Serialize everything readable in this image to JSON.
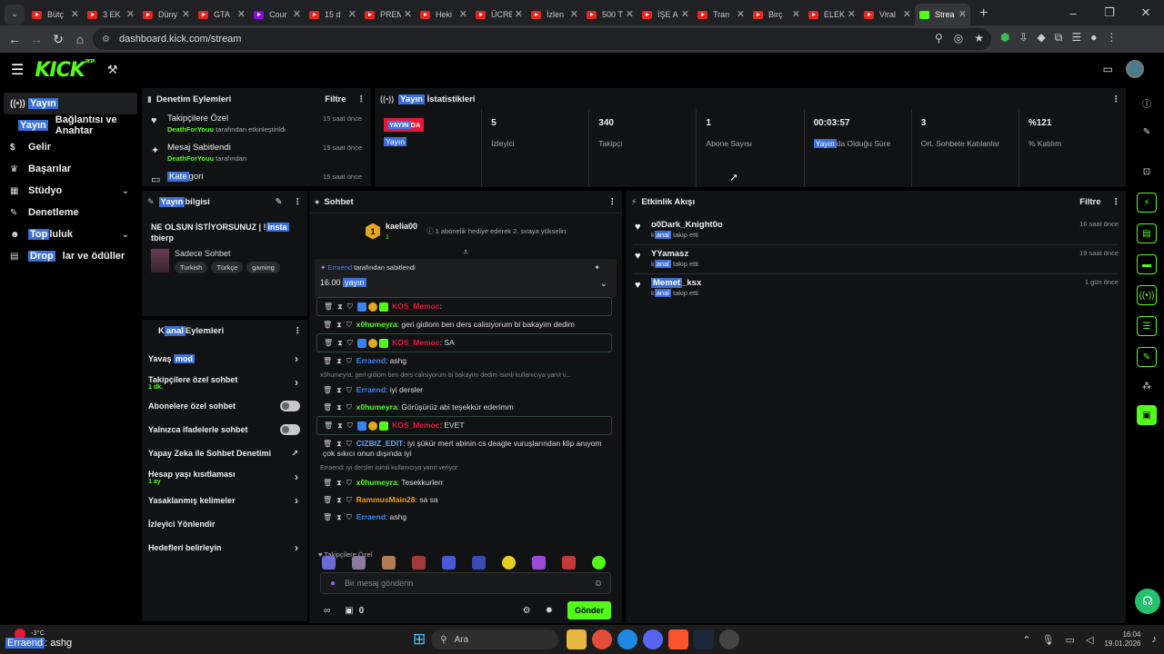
{
  "browser": {
    "tabs": [
      {
        "label": "Bütç"
      },
      {
        "label": "3 EK"
      },
      {
        "label": "Düny"
      },
      {
        "label": "GTA"
      },
      {
        "label": "Cour"
      },
      {
        "label": "15 d"
      },
      {
        "label": "PREM"
      },
      {
        "label": "Heki"
      },
      {
        "label": "ÜCRE"
      },
      {
        "label": "İzlen"
      },
      {
        "label": "500 T"
      },
      {
        "label": "İŞE A"
      },
      {
        "label": "Tran"
      },
      {
        "label": "Birç"
      },
      {
        "label": "ELEK"
      },
      {
        "label": "Viral"
      },
      {
        "label": "Strea"
      }
    ],
    "url": "dashboard.kick.com/stream"
  },
  "header": {
    "logo": "KICK",
    "logo_badge": "BETA"
  },
  "sidebar": {
    "items": [
      {
        "label": "Yayın",
        "icon": "broadcast-icon"
      },
      {
        "label_hl": "Yayın",
        "label": "Bağlantısı ve Anahtar"
      },
      {
        "label": "Gelir",
        "icon": "dollar-icon"
      },
      {
        "label": "Başarılar",
        "icon": "trophy-icon"
      },
      {
        "label": "Stüdyo",
        "icon": "grid-icon"
      },
      {
        "label": "Denetleme",
        "icon": "wrench-icon"
      },
      {
        "label_hl": "Top",
        "label": "luluk",
        "icon": "people-icon"
      },
      {
        "label_hl": "Drop",
        "label": "lar ve ödüller",
        "icon": "gift-icon"
      }
    ]
  },
  "mod_actions": {
    "title": "Denetim Eylemleri",
    "filter": "Filtre",
    "rows": [
      {
        "title": "Takipçilere Özel",
        "by": "DeathForYouu",
        "suffix": "tarafından etkinleştirildi",
        "time": "15 saat önce"
      },
      {
        "title": "Mesaj Sabitlendi",
        "by": "DeathForYouu",
        "suffix": "tarafından",
        "time": "15 saat önce"
      },
      {
        "title_hl": "Kate",
        "title": "gori",
        "time": "15 saat önce"
      }
    ]
  },
  "stats": {
    "title_hl": "Yayın",
    "title": "İstatistikleri",
    "live_badge_hl": "YAYIN",
    "live_badge": "DA",
    "live_sub": "Yayın",
    "cells": [
      {
        "value": "5",
        "label": "İzleyici"
      },
      {
        "value": "340",
        "label": "Takipçi"
      },
      {
        "value": "1",
        "label": "Abone Sayısı"
      },
      {
        "value": "00:03:57",
        "label_hl": "Yayın",
        "label": "da Olduğu Süre"
      },
      {
        "value": "3",
        "label": "Ort. Sohbete Katılanlar"
      },
      {
        "value": "%121",
        "label": "% Katılım"
      }
    ]
  },
  "stream_info": {
    "title_hl": "Yayın",
    "title": " bilgisi",
    "stream_title_a": "NE OLSUN İSTİYORSUNUZ | !",
    "stream_title_hl": "insta",
    "stream_title_b": "tbierp",
    "category": "Sadece Sohbet",
    "tags": [
      "Turkish",
      "Türkçe",
      "gaming"
    ]
  },
  "channel_actions": {
    "title_a": "K",
    "title_hl": "anal",
    "title_b": " Eylemleri",
    "rows": [
      {
        "label_a": "Yavaş ",
        "label_hl": "mod",
        "control": "arrow"
      },
      {
        "label": "Takipçilere özel sohbet",
        "sub": "1 dk.",
        "control": "arrow"
      },
      {
        "label": "Abonelere özel sohbet",
        "control": "toggle"
      },
      {
        "label": "Yalnızca ifadelerle sohbet",
        "control": "toggle"
      },
      {
        "label": "Yapay Zeka ile Sohbet Denetimi",
        "control": "external"
      },
      {
        "label": "Hesap yaşı kısıtlaması",
        "sub": "1 ay",
        "control": "arrow"
      },
      {
        "label": "Yasaklanmış kelimeler",
        "control": "arrow"
      },
      {
        "label": "İzleyici Yönlendir",
        "control": "none"
      },
      {
        "label": "Hedefleri belirleyin",
        "control": "arrow"
      }
    ]
  },
  "chat": {
    "title": "Sohbet",
    "gift": {
      "user": "kaelia00",
      "count": "1",
      "text": "1 abonelik hediye ederek 2. sıraya yükselin"
    },
    "pinned": {
      "by": "Erraend",
      "by_suffix": "tarafından sabitlendi",
      "text": "16.00 ",
      "text_hl": "yayın"
    },
    "messages": [
      {
        "user": "KOS_Memoc",
        "text": "",
        "color": "#e9183a",
        "boxed": true
      },
      {
        "user": "x0humeyra",
        "text": "geri gidiom ben ders calisiyorum bi bakayim dedim",
        "color": "#53fc18",
        "boxed": false
      },
      {
        "user": "KOS_Memoc",
        "text": "SA",
        "color": "#e9183a",
        "boxed": true
      },
      {
        "user": "Erraend",
        "text": "ashg",
        "color": "#3b82f6",
        "boxed": false
      },
      {
        "reply": "x0humeyra: geri gidiom ben ders calisiyorum bi bakayim dedim isimli kullanıcıya yanıt v...",
        "user": "Erraend",
        "text": "iyi dersler",
        "color": "#3b82f6",
        "boxed": false
      },
      {
        "user": "x0humeyra",
        "text": "Görüşürüz abi teşekkür ederimm",
        "color": "#53fc18",
        "boxed": false
      },
      {
        "user": "KOS_Memoc",
        "text": "EVET",
        "color": "#e9183a",
        "boxed": true
      },
      {
        "user": "CIZBIZ_EDIT",
        "text": "iyi şükür mert abinin cs deagle vuruşlarından klip anıyom çok sıkıcı onun dışında iyi",
        "color": "#60a5fa",
        "boxed": false
      },
      {
        "reply": "Erraend: iyi dersler isimli kullanıcıya yanıt veriyor",
        "user": "x0humeyra",
        "text": "Tesekkurlerr",
        "color": "#53fc18",
        "boxed": false
      },
      {
        "user": "RammusMain28",
        "text": "sa sa",
        "color": "#f59e0b",
        "boxed": false
      },
      {
        "user": "Erraend",
        "text": "ashg",
        "color": "#3b82f6",
        "boxed": false
      }
    ],
    "emote_label": "Takipçilere Özel",
    "input_placeholder": "Bir mesaj gönderin",
    "points": "0",
    "send": "Gönder"
  },
  "activity": {
    "title": "Etkinlik Akışı",
    "filter": "Filtre",
    "events": [
      {
        "name": "o0Dark_Knight0o",
        "sub_a": "k",
        "sub_hl": "anal",
        "sub_b": " takip etti",
        "time": "16 saat önce"
      },
      {
        "name": "YYamasz",
        "sub_a": "k",
        "sub_hl": "anal",
        "sub_b": " takip etti",
        "time": "19 saat önce"
      },
      {
        "name_hl": "Memet",
        "name": "_ksx",
        "sub_a": "k",
        "sub_hl": "anal",
        "sub_b": " takip etti",
        "time": "1 gün önce"
      }
    ]
  },
  "taskbar": {
    "weather": "-3°C",
    "preview_hl": "Erraend",
    "preview": ": ashg",
    "search": "Ara",
    "time": "16:04",
    "date": "19.01.2026"
  }
}
